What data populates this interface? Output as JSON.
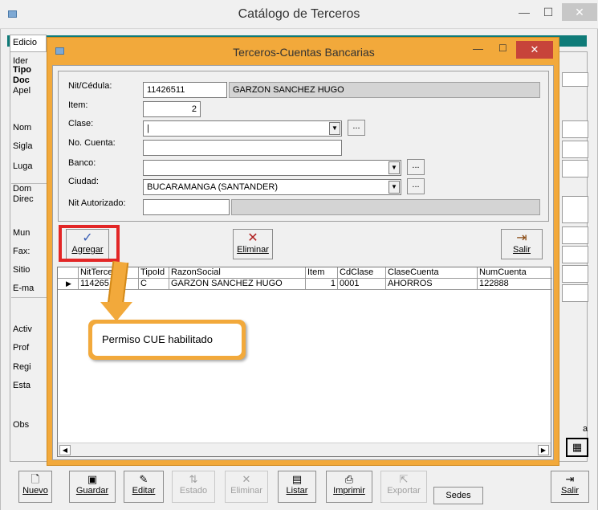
{
  "outer_window": {
    "title": "Catálogo de Terceros",
    "tab_edicion": "Edicio",
    "side_labels": [
      "Ider",
      "Tipo",
      "Doc",
      "Apel",
      "Nom",
      "Sigla",
      "Luga",
      "Dom",
      "Direc",
      "Mun",
      "Fax:",
      "Sitio",
      "E-ma",
      "Activ",
      "Prof",
      "Regi",
      "Esta",
      "Obs"
    ],
    "right_edge_label": "a",
    "toolbar": {
      "nuevo": "Nuevo",
      "guardar": "Guardar",
      "editar": "Editar",
      "estado": "Estado",
      "eliminar": "Eliminar",
      "listar": "Listar",
      "imprimir": "Imprimir",
      "exportar": "Exportar",
      "sedes": "Sedes",
      "salir": "Salir"
    }
  },
  "dialog": {
    "title": "Terceros-Cuentas Bancarias",
    "fields": {
      "nit_label": "Nit/Cédula:",
      "nit_value": "11426511",
      "nombre_value": "GARZON SANCHEZ HUGO",
      "item_label": "Item:",
      "item_value": "2",
      "clase_label": "Clase:",
      "clase_value": "|",
      "cuenta_label": "No. Cuenta:",
      "cuenta_value": "",
      "banco_label": "Banco:",
      "banco_value": "",
      "ciudad_label": "Ciudad:",
      "ciudad_value": "BUCARAMANGA  (SANTANDER)",
      "nit_aut_label": "Nit Autorizado:",
      "nit_aut_value": "",
      "ellipsis": "..."
    },
    "buttons": {
      "agregar": "Agregar",
      "eliminar": "Eliminar",
      "salir": "Salir"
    },
    "grid": {
      "headers": [
        "NitTercero",
        "TipoId",
        "RazonSocial",
        "Item",
        "CdClase",
        "ClaseCuenta",
        "NumCuenta"
      ],
      "rows": [
        [
          "114265",
          "C",
          "GARZON SANCHEZ HUGO",
          "1",
          "0001",
          "AHORROS",
          "122888"
        ]
      ]
    }
  },
  "callout": {
    "text": "Permiso CUE habilitado"
  },
  "colors": {
    "accent_orange": "#f2a93b",
    "highlight_red": "#e22626",
    "tab_teal": "#0f7b78",
    "close_red": "#c7443a"
  }
}
